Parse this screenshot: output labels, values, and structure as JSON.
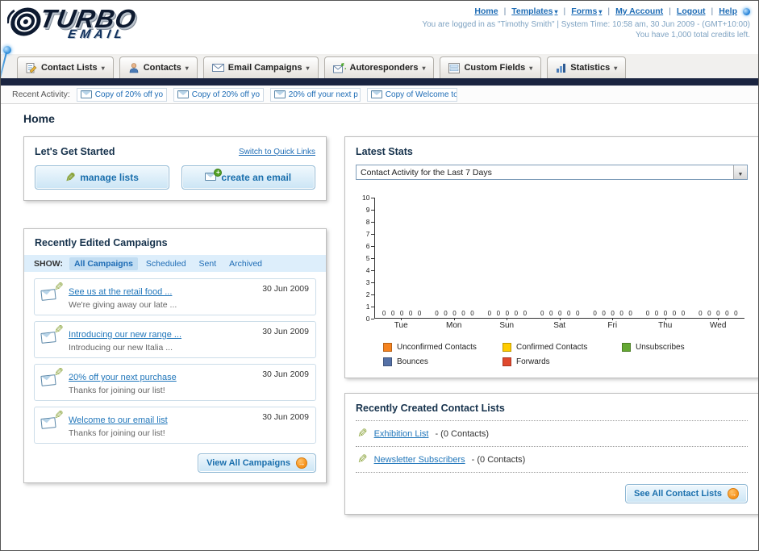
{
  "logo": {
    "title": "TURBO",
    "subtitle": "EMAIL"
  },
  "header": {
    "nav_links": [
      "Home",
      "Templates",
      "Forms",
      "My Account",
      "Logout",
      "Help"
    ],
    "login_info": "You are logged in as \"Timothy Smith\" | System Time: 10:58 am, 30 Jun 2009 - (GMT+10:00)",
    "credits": "You have 1,000 total credits left."
  },
  "nav_tabs": [
    {
      "label": "Contact Lists"
    },
    {
      "label": "Contacts"
    },
    {
      "label": "Email Campaigns"
    },
    {
      "label": "Autoresponders"
    },
    {
      "label": "Custom Fields"
    },
    {
      "label": "Statistics"
    }
  ],
  "recent_activity": {
    "label": "Recent Activity:",
    "items": [
      "Copy of 20% off yo",
      "Copy of 20% off yo",
      "20% off your next p",
      "Copy of Welcome to"
    ]
  },
  "page_title": "Home",
  "get_started": {
    "title": "Let's Get Started",
    "switch_link": "Switch to Quick Links",
    "manage_label": "manage lists",
    "create_label": "create an email"
  },
  "campaigns": {
    "title": "Recently Edited Campaigns",
    "show_label": "SHOW:",
    "filters": [
      "All Campaigns",
      "Scheduled",
      "Sent",
      "Archived"
    ],
    "items": [
      {
        "title": "See us at the retail food ...",
        "subtitle": "We're giving away our late ...",
        "date": "30 Jun 2009"
      },
      {
        "title": "Introducing our new range ...",
        "subtitle": "Introducing our new Italia ...",
        "date": "30 Jun 2009"
      },
      {
        "title": "20% off your next purchase",
        "subtitle": "Thanks for joining our list!",
        "date": "30 Jun 2009"
      },
      {
        "title": "Welcome to our email list",
        "subtitle": "Thanks for joining our list!",
        "date": "30 Jun 2009"
      }
    ],
    "view_all": "View All Campaigns"
  },
  "latest_stats": {
    "title": "Latest Stats",
    "dropdown_value": "Contact Activity for the Last 7 Days",
    "chart_data": {
      "type": "bar",
      "title": "Contact Activity for the Last 7 Days",
      "categories": [
        "Tue",
        "Mon",
        "Sun",
        "Sat",
        "Fri",
        "Thu",
        "Wed"
      ],
      "series": [
        {
          "name": "Unconfirmed Contacts",
          "color": "#f5831f",
          "values": [
            0,
            0,
            0,
            0,
            0,
            0,
            0
          ]
        },
        {
          "name": "Confirmed Contacts",
          "color": "#ffcc00",
          "values": [
            0,
            0,
            0,
            0,
            0,
            0,
            0
          ]
        },
        {
          "name": "Unsubscribes",
          "color": "#64a832",
          "values": [
            0,
            0,
            0,
            0,
            0,
            0,
            0
          ]
        },
        {
          "name": "Bounces",
          "color": "#5571a7",
          "values": [
            0,
            0,
            0,
            0,
            0,
            0,
            0
          ]
        },
        {
          "name": "Forwards",
          "color": "#e0492e",
          "values": [
            0,
            0,
            0,
            0,
            0,
            0,
            0
          ]
        }
      ],
      "ylim": [
        0,
        10
      ],
      "grid": false,
      "legend_position": "bottom"
    }
  },
  "contact_lists": {
    "title": "Recently Created Contact Lists",
    "items": [
      {
        "name": "Exhibition List",
        "suffix": "- (0 Contacts)"
      },
      {
        "name": "Newsletter Subscribers",
        "suffix": "- (0 Contacts)"
      }
    ],
    "see_all": "See All Contact Lists"
  },
  "colors": {
    "link_blue": "#1e6cb5",
    "accent_orange": "#f7941d",
    "dark_bar": "#1a2440",
    "title_navy": "#16324c"
  }
}
